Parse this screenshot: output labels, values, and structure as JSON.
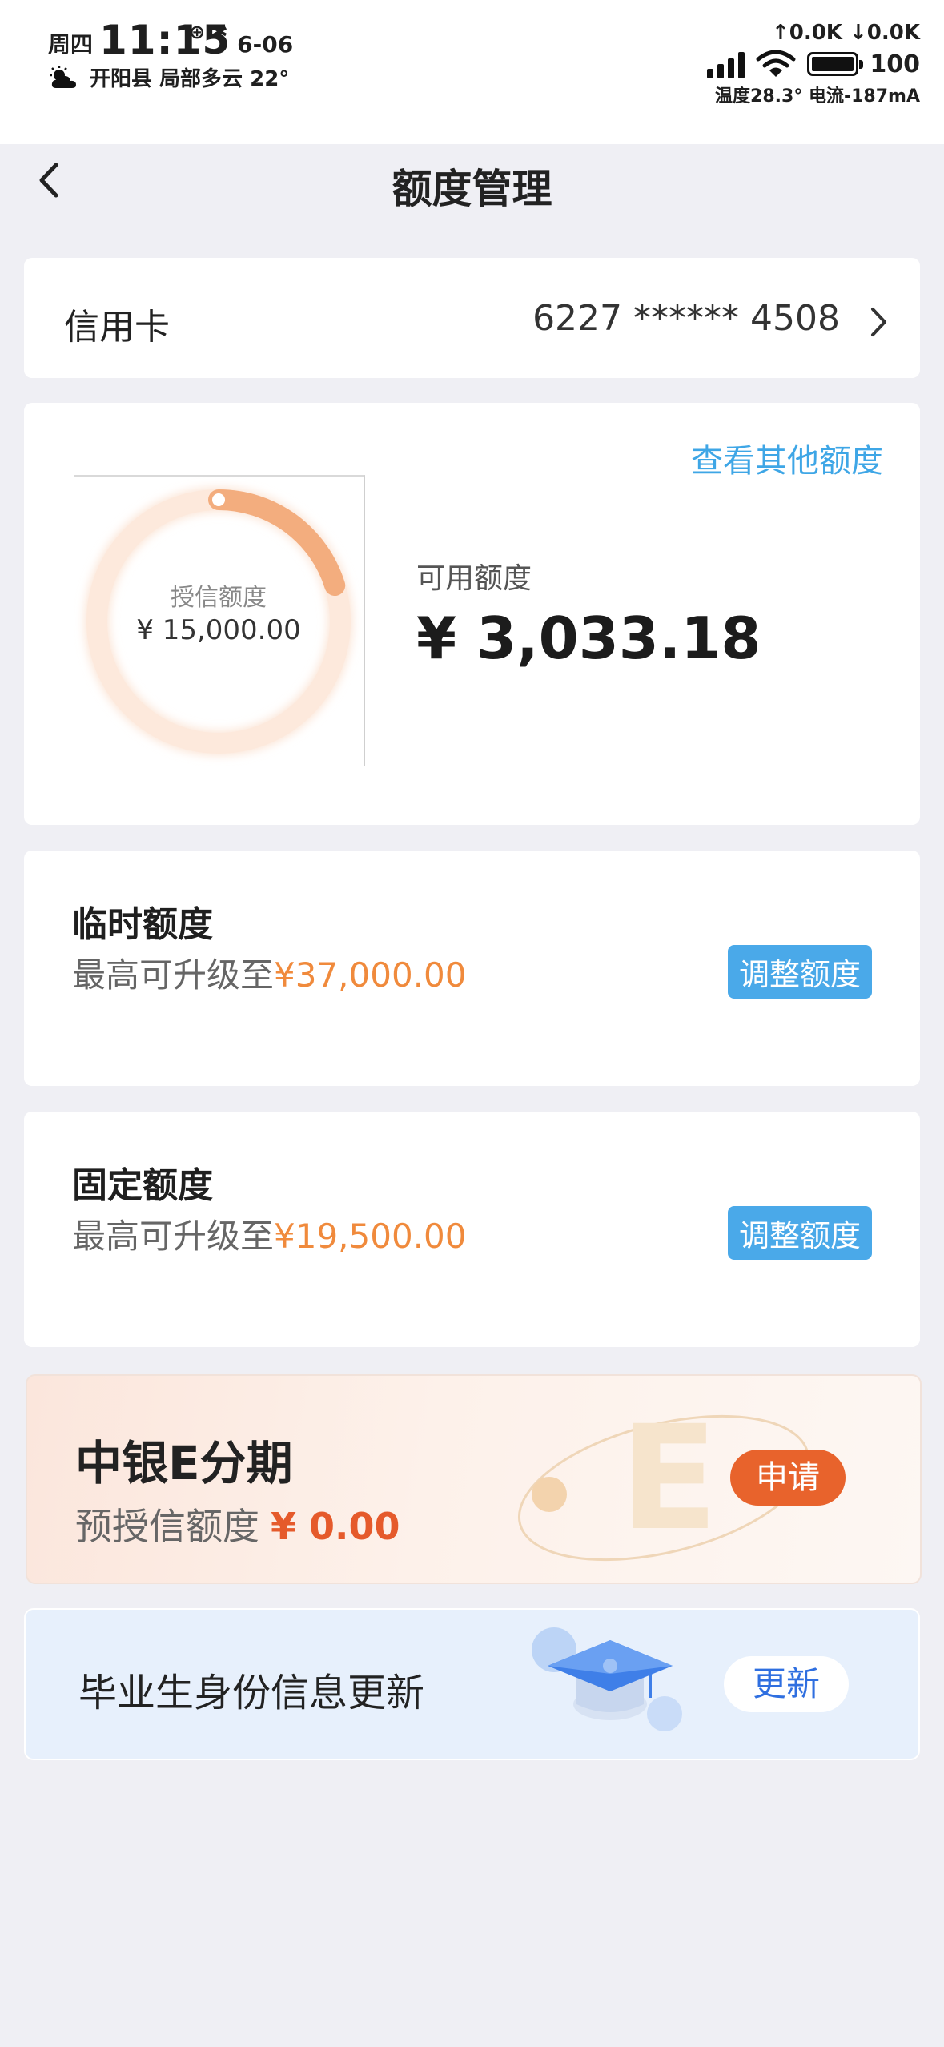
{
  "status_bar": {
    "weekday": "周四",
    "time": "11:15",
    "date": "6-06",
    "location_weather": "开阳县 局部多云 22°",
    "network_speed": "↑0.0K ↓0.0K",
    "battery": "100",
    "temp_current": "温度28.3° 电流-187mA"
  },
  "nav": {
    "title": "额度管理"
  },
  "card_selector": {
    "label": "信用卡",
    "number": "6227 ****** 4508"
  },
  "quota": {
    "other_link": "查看其他额度",
    "credit_label": "授信额度",
    "credit_value": "¥ 15,000.00",
    "available_label": "可用额度",
    "available_value": "¥ 3,033.18",
    "available_fraction": 0.2022
  },
  "temporary": {
    "title": "临时额度",
    "prefix": "最高可升级至",
    "amount": "¥37,000.00",
    "button": "调整额度"
  },
  "fixed": {
    "title": "固定额度",
    "prefix": "最高可升级至",
    "amount": "¥19,500.00",
    "button": "调整额度"
  },
  "installment": {
    "title": "中银E分期",
    "label": "预授信额度",
    "amount": "¥ 0.00",
    "button": "申请"
  },
  "graduate": {
    "title": "毕业生身份信息更新",
    "button": "更新"
  },
  "colors": {
    "accent_blue": "#4aa9e9",
    "accent_orange": "#f08a3c",
    "apply_orange": "#e8632c",
    "page_bg": "#efeff4"
  }
}
